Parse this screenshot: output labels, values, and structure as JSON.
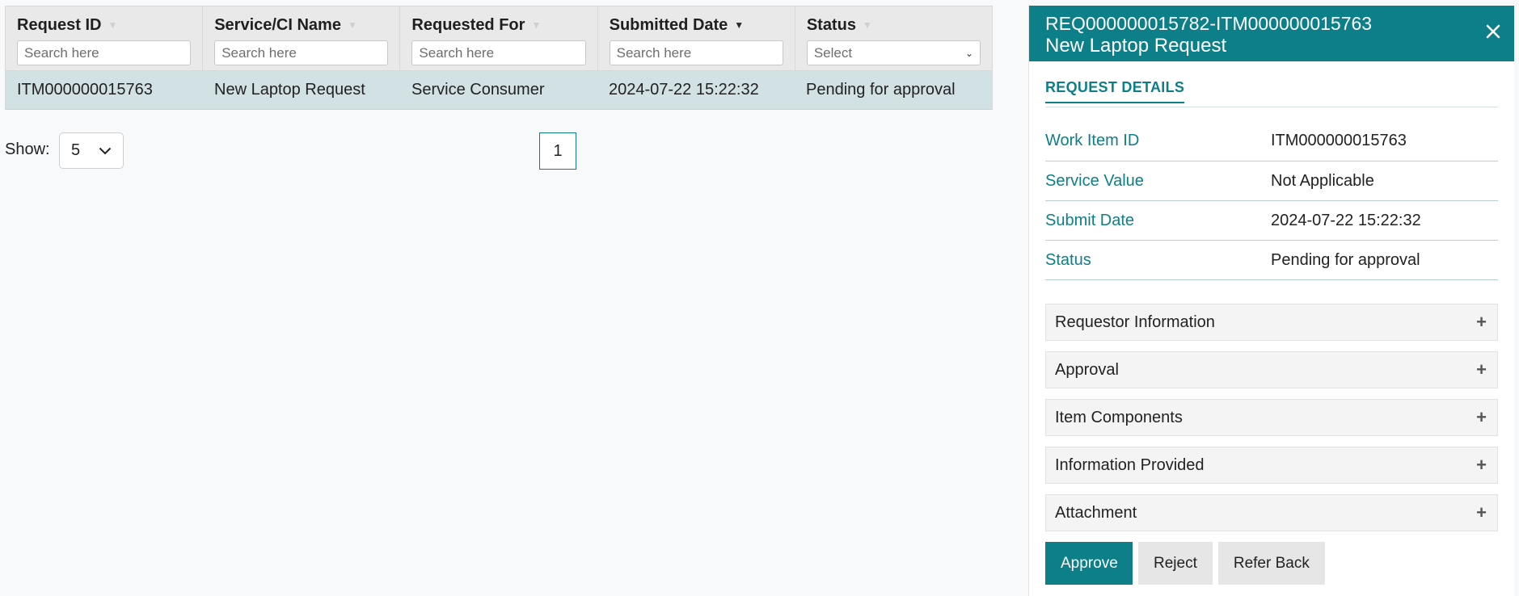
{
  "grid": {
    "columns": [
      {
        "label": "Request ID",
        "filter_placeholder": "Search here",
        "sorted": false
      },
      {
        "label": "Service/CI Name",
        "filter_placeholder": "Search here",
        "sorted": false
      },
      {
        "label": "Requested For",
        "filter_placeholder": "Search here",
        "sorted": false
      },
      {
        "label": "Submitted Date",
        "filter_placeholder": "Search here",
        "sorted": true
      },
      {
        "label": "Status",
        "filter_placeholder": "Select",
        "sorted": false
      }
    ],
    "rows": [
      {
        "request_id": "ITM000000015763",
        "service_name": "New Laptop Request",
        "requested_for": "Service Consumer",
        "submitted_date": "2024-07-22 15:22:32",
        "status": "Pending for approval"
      }
    ]
  },
  "pager": {
    "show_label": "Show:",
    "page_size": "5",
    "current_page": "1"
  },
  "panel": {
    "title_line1": "REQ000000015782-ITM000000015763",
    "title_line2": "New Laptop Request",
    "tab_label": "REQUEST DETAILS",
    "details": [
      {
        "label": "Work Item ID",
        "value": "ITM000000015763"
      },
      {
        "label": "Service Value",
        "value": "Not Applicable"
      },
      {
        "label": "Submit Date",
        "value": "2024-07-22 15:22:32"
      },
      {
        "label": "Status",
        "value": "Pending for approval"
      }
    ],
    "sections": [
      {
        "label": "Requestor Information"
      },
      {
        "label": "Approval"
      },
      {
        "label": "Item Components"
      },
      {
        "label": "Information Provided"
      },
      {
        "label": "Attachment"
      }
    ],
    "buttons": {
      "approve": "Approve",
      "reject": "Reject",
      "refer_back": "Refer Back"
    }
  },
  "colors": {
    "accent": "#0c7f88",
    "selected_row": "#d1e1e4",
    "header_bg": "#e9e9e9"
  }
}
